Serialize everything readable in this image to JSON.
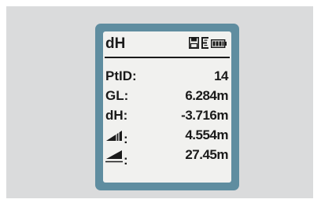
{
  "screen": {
    "title": "dH",
    "status_icons": [
      "save-icon",
      "memory-icon",
      "battery-icon"
    ]
  },
  "rows": [
    {
      "label": "PtID:",
      "value": "14"
    },
    {
      "label": "GL:",
      "value": "6.284m"
    },
    {
      "label": "dH:",
      "value": "-3.716m"
    },
    {
      "label": ":",
      "icon": "slope-vertical-icon",
      "value": "4.554m"
    },
    {
      "label": ":",
      "icon": "slope-horizontal-icon",
      "value": "27.45m"
    }
  ],
  "colors": {
    "device_frame": "#5f8da0",
    "screen_bg": "#f1f1ef",
    "panel_bg": "#dadbdc",
    "text": "#1a1a1a"
  }
}
